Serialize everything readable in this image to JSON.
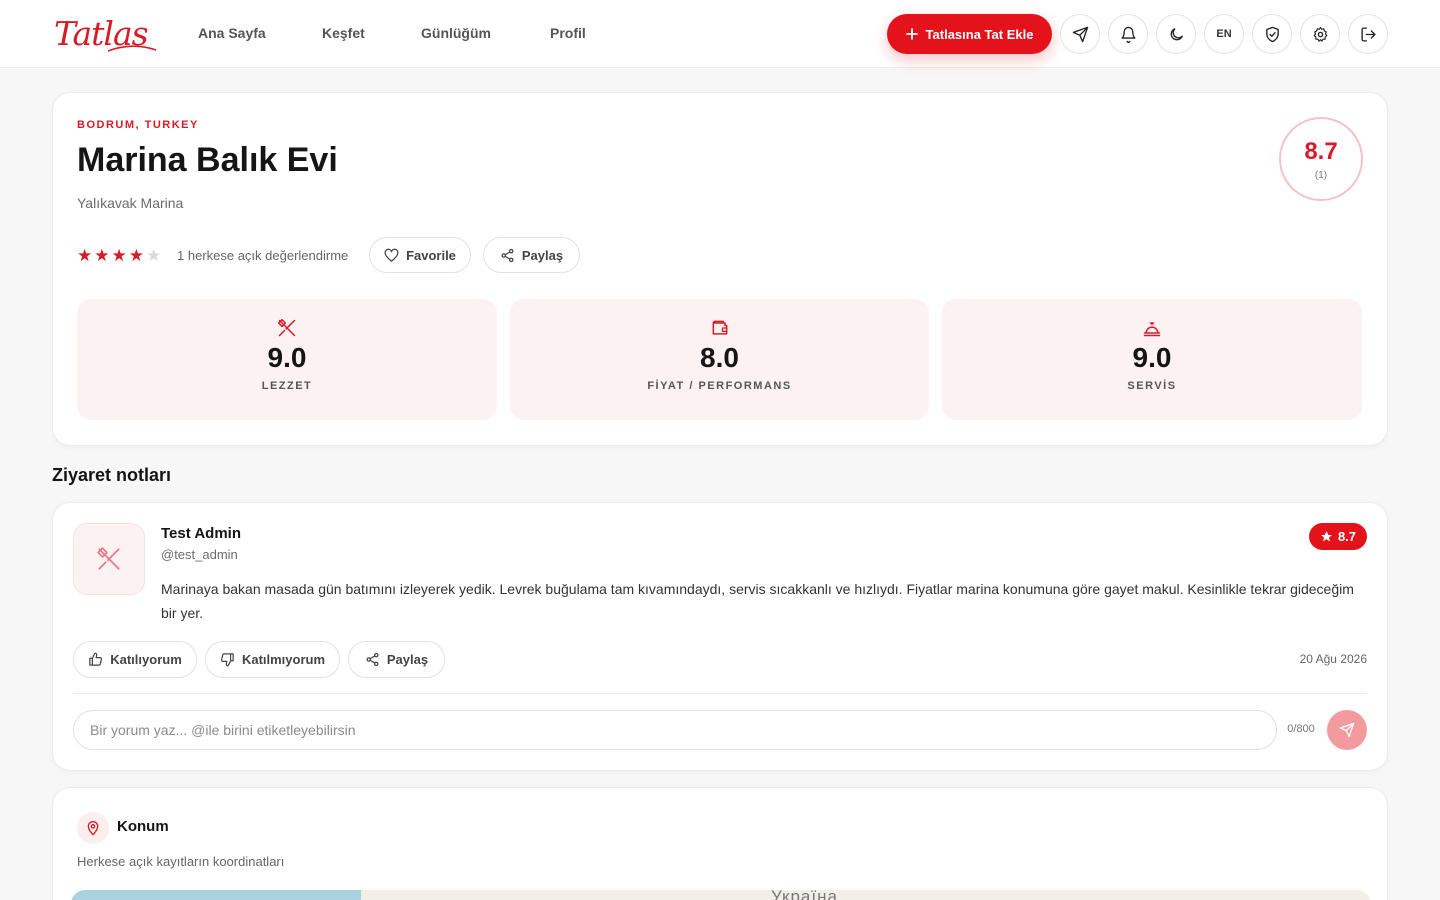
{
  "brand": {
    "logo_text": "Tatlas",
    "accent_color": "#d81b27"
  },
  "nav": {
    "items": [
      "Ana Sayfa",
      "Keşfet",
      "Günlüğüm",
      "Profil"
    ]
  },
  "header": {
    "add_button": "Tatlasına Tat Ekle",
    "language": "EN",
    "icons": [
      "send-icon",
      "bell-icon",
      "moon-icon",
      "shield-check-icon",
      "gear-icon",
      "logout-icon"
    ]
  },
  "place": {
    "location": "BODRUM, TURKEY",
    "name": "Marina Balık Evi",
    "area": "Yalıkavak Marina",
    "overall_score": "8.7",
    "rating_count": "(1)",
    "stars_filled": 4,
    "stars_total": 5,
    "rating_text": "1 herkese açık değerlendirme",
    "favorite_label": "Favorile",
    "share_label": "Paylaş"
  },
  "metrics": [
    {
      "value": "9.0",
      "label": "LEZZET",
      "icon": "utensils-icon"
    },
    {
      "value": "8.0",
      "label": "FİYAT / PERFORMANS",
      "icon": "wallet-icon"
    },
    {
      "value": "9.0",
      "label": "SERVİS",
      "icon": "cloche-icon"
    }
  ],
  "visits": {
    "section_title": "Ziyaret notları",
    "entry": {
      "user_name": "Test Admin",
      "user_handle": "@test_admin",
      "score": "8.7",
      "note": "Marinaya bakan masada gün batımını izleyerek yedik. Levrek buğulama tam kıvamındaydı, servis sıcakkanlı ve hızlıydı. Fiyatlar marina konumuna göre gayet makul. Kesinlikle tekrar gideceğim bir yer.",
      "agree_label": "Katılıyorum",
      "disagree_label": "Katılmıyorum",
      "share_label": "Paylaş",
      "date": "20 Ağu 2026",
      "comment_placeholder": "Bir yorum yaz... @ile birini etiketleyebilirsin",
      "comment_value": "",
      "char_counter": "0/800"
    }
  },
  "location_section": {
    "title": "Konum",
    "subtitle": "Herkese açık kayıtların koordinatları",
    "map_label": "Україна"
  }
}
